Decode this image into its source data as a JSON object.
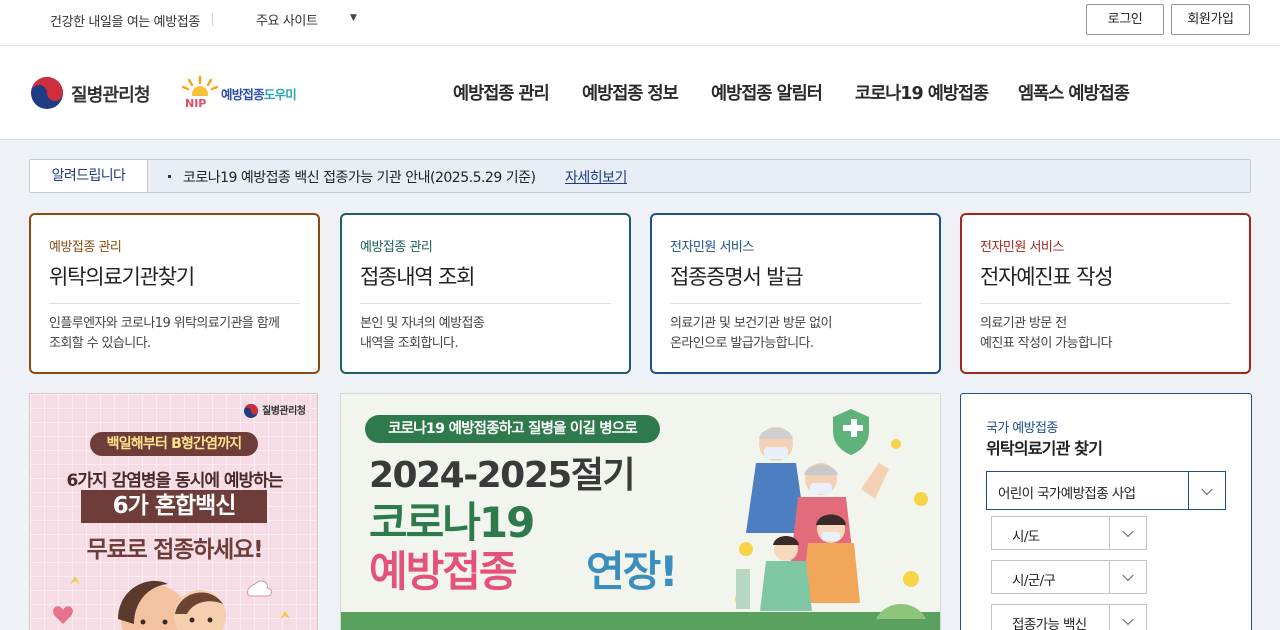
{
  "topbar": {
    "slogan": "건강한 내일을 여는 예방접종",
    "sites_label": "주요 사이트",
    "sites_caret": "▼",
    "login": "로그인",
    "join": "회원가입"
  },
  "header": {
    "agency_name": "질병관리청",
    "nip_logo_text": "NIP",
    "nip_name_a": "예방접종",
    "nip_name_b": "도우미",
    "nav": [
      "예방접종 관리",
      "예방접종 정보",
      "예방접종 알림터",
      "코로나19 예방접종",
      "엠폭스 예방접종"
    ]
  },
  "notice": {
    "tag": "알려드립니다",
    "text": "코로나19 예방접종 백신 접종가능 기관 안내(2025.5.29 기준)",
    "more": "자세히보기"
  },
  "cards": [
    {
      "category": "예방접종 관리",
      "title": "위탁의료기관찾기",
      "desc1": "인플루엔자와 코로나19 위탁의료기관을 함께",
      "desc2": "조회할 수 있습니다.",
      "color": "#8a4b12"
    },
    {
      "category": "예방접종 관리",
      "title": "접종내역 조회",
      "desc1": "본인 및 자녀의 예방접종",
      "desc2": "내역을 조회합니다.",
      "color": "#1f5e5a"
    },
    {
      "category": "전자민원 서비스",
      "title": "접종증명서 발급",
      "desc1": "의료기관 및 보건기관 방문 없이",
      "desc2": "온라인으로 발급가능합니다.",
      "color": "#1d4f8f"
    },
    {
      "category": "전자민원 서비스",
      "title": "전자예진표 작성",
      "desc1": "의료기관 방문 전",
      "desc2": "예진표 작성이 가능합니다",
      "color": "#a3261c"
    }
  ],
  "banner1": {
    "org": "질병관리청",
    "pill": "백일해부터 B형간염까지",
    "line1": "6가지 감염병을 동시에 예방하는",
    "line2": "6가 혼합백신",
    "line3": "무료로 접종하세요!"
  },
  "banner2": {
    "pill": "코로나19 예방접종하고 질병을 이길 병으로",
    "line1": "2024-2025절기",
    "line2": "코로나19",
    "line3a": "예방접종",
    "line3b": "연장!"
  },
  "finder": {
    "subtitle": "국가 예방접종",
    "title": "위탁의료기관 찾기",
    "program": "어린이 국가예방접종 사업",
    "sido": "시/도",
    "sigungu": "시/군/구",
    "vaccine": "접종가능 백신"
  },
  "colors": {
    "brand_navy": "#1d4f8f",
    "card_brown": "#8a4b12",
    "card_teal": "#1f5e5a",
    "card_red": "#a3261c"
  }
}
